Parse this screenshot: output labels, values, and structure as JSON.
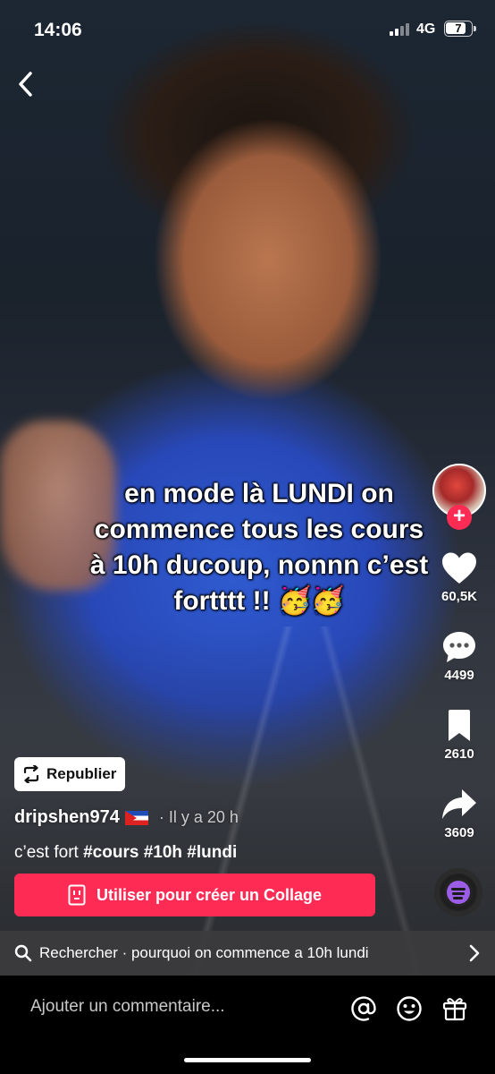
{
  "status_bar": {
    "time": "14:06",
    "network": "4G",
    "battery": "7"
  },
  "caption_lines": [
    "en mode là LUNDI on",
    "commence tous les cours",
    "à 10h ducoup, nonnn c’est",
    "fortttt !! 🥳🥳"
  ],
  "actions": {
    "likes": "60,5K",
    "comments": "4499",
    "saves": "2610",
    "shares": "3609"
  },
  "repost_label": "Republier",
  "author": {
    "username": "dripshen974",
    "time_ago": "· Il y a 20 h"
  },
  "description": {
    "text": "c’est fort",
    "tags": [
      "#cours",
      "#10h",
      "#lundi"
    ]
  },
  "collage_button": "Utiliser pour créer un Collage",
  "search": {
    "label": "Rechercher · pourquoi on commence a 10h lundi"
  },
  "comment_input": {
    "placeholder": "Ajouter un commentaire..."
  },
  "colors": {
    "accent": "#fe2c55",
    "sound_disc": "#9b5de5"
  }
}
